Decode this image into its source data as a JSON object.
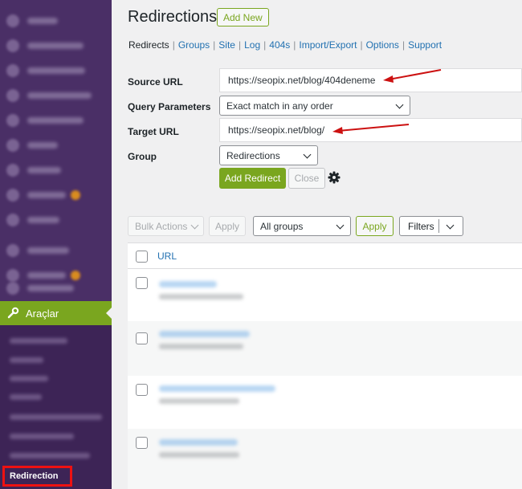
{
  "sidebar": {
    "active_item_label": "Araçlar",
    "highlighted_submenu_label": "Redirection",
    "colors": {
      "background": "#4a2f66",
      "active": "#7aa61f",
      "highlight_border": "#ee1111"
    }
  },
  "header": {
    "title": "Redirections",
    "add_new_label": "Add New"
  },
  "subnav": {
    "current": "Redirects",
    "links": [
      "Groups",
      "Site",
      "Log",
      "404s",
      "Import/Export",
      "Options",
      "Support"
    ]
  },
  "form": {
    "source_url_label": "Source URL",
    "source_url_value": "https://seopix.net/blog/404deneme",
    "query_params_label": "Query Parameters",
    "query_params_value": "Exact match in any order",
    "target_url_label": "Target URL",
    "target_url_value": "https://seopix.net/blog/",
    "group_label": "Group",
    "group_value": "Redirections",
    "add_redirect_label": "Add Redirect",
    "close_label": "Close",
    "settings_icon": "gear-icon"
  },
  "toolbar": {
    "bulk_actions_label": "Bulk Actions",
    "apply_label": "Apply",
    "groups_filter_value": "All groups",
    "apply_filter_label": "Apply",
    "filters_label": "Filters"
  },
  "table": {
    "column_url": "URL"
  },
  "colors": {
    "accent": "#7aa61f",
    "link": "#2271b1",
    "annotation_arrow": "#cc1111"
  }
}
